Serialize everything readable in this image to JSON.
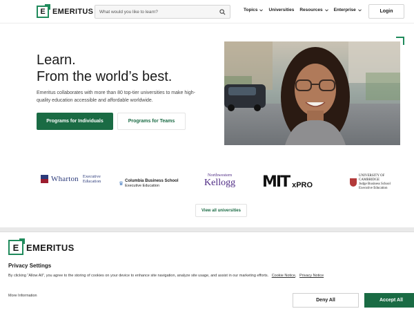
{
  "header": {
    "logo_text": "EMERITUS",
    "logo_mark": "E",
    "search_placeholder": "What would you like to learn?",
    "nav": [
      "Topics",
      "Universities",
      "Resources",
      "Enterprise"
    ],
    "login_label": "Login"
  },
  "hero": {
    "title_line1": "Learn.",
    "title_line2": "From the world’s best.",
    "description": "Emeritus collaborates with more than 80 top-tier universities to make high-quality education accessible and affordable worldwide.",
    "primary_button": "Programs for Individuals",
    "secondary_button": "Programs for Teams"
  },
  "universities": {
    "wharton_name": "Wharton",
    "wharton_sub1": "Executive",
    "wharton_sub2": "Education",
    "columbia_name": "Columbia Business School",
    "columbia_sub": "Executive Education",
    "kellogg_line1": "Northwestern",
    "kellogg_line2": "Kellogg",
    "mit_logo": "MIT",
    "mit_xpro": "xPRO",
    "cambridge_line1": "UNIVERSITY OF",
    "cambridge_line2": "CAMBRIDGE",
    "cambridge_line3": "Judge Business School",
    "cambridge_line4": "Executive Education",
    "view_all_label": "View all universities"
  },
  "cookie_banner": {
    "logo_text": "EMERITUS",
    "logo_mark": "E",
    "title": "Privacy Settings",
    "text": "By clicking “Allow All”, you agree to the storing of cookies on your device to enhance site navigation, analyze site usage, and assist in our marketing efforts.",
    "cookie_notice_link": "Cookie Notice",
    "privacy_notice_link": "Privacy Notice",
    "more_info": "More Information",
    "deny_label": "Deny All",
    "accept_label": "Accept All"
  },
  "colors": {
    "brand_green": "#1a6b44",
    "accent_green": "#1f8a5b"
  }
}
